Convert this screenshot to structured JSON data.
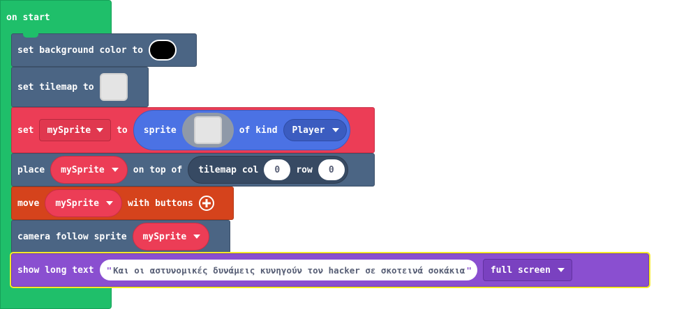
{
  "on_start": {
    "label": "on start",
    "color": "#1fbf6a"
  },
  "set_background": {
    "label": "set background color to",
    "color_value": "#000000"
  },
  "set_tilemap": {
    "label": "set tilemap to"
  },
  "set_sprite": {
    "set_label": "set",
    "variable": "mySprite",
    "to_label": "to",
    "sprite_label": "sprite",
    "of_kind_label": "of kind",
    "kind": "Player"
  },
  "place": {
    "label": "place",
    "variable": "mySprite",
    "on_top_label": "on top of",
    "tilemap_col_label": "tilemap col",
    "col": "0",
    "row_label": "row",
    "row": "0"
  },
  "move": {
    "label": "move",
    "variable": "mySprite",
    "with_buttons_label": "with buttons"
  },
  "camera": {
    "label": "camera follow sprite",
    "variable": "mySprite"
  },
  "show_text": {
    "label": "show long text",
    "text": "Και οι αστυνομικές δυνάμεις κυνηγούν τον hacker σε σκοτεινά σοκάκια",
    "quote_open": "\"",
    "quote_close": "\"",
    "mode": "full screen"
  },
  "icons": [
    "caret-down-icon",
    "plus-circle-icon"
  ]
}
